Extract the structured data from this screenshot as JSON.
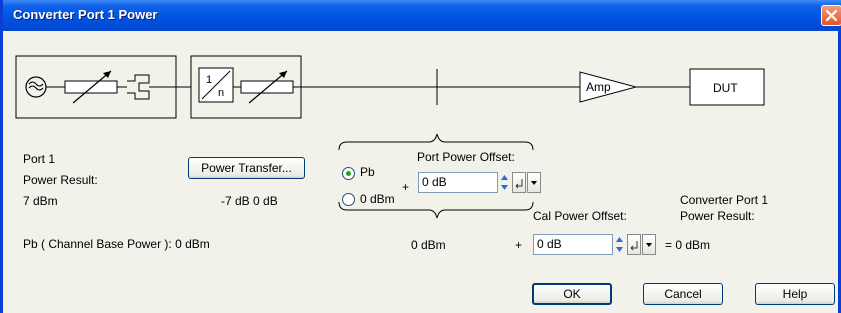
{
  "window": {
    "title": "Converter Port 1 Power"
  },
  "diagram": {
    "divider_label": "1",
    "divider_sublabel": "n",
    "amp_label": "Amp",
    "dut_label": "DUT"
  },
  "left_panel": {
    "port_label": "Port 1",
    "power_result_label": "Power Result:",
    "power_result_value": "7 dBm",
    "power_transfer_button": "Power Transfer...",
    "transfer_values": "-7 dB  0 dB",
    "channel_base_power": "Pb ( Channel Base Power ): 0 dBm"
  },
  "port_power": {
    "offset_label": "Port Power Offset:",
    "radio_options": [
      {
        "label": "Pb",
        "selected": true
      },
      {
        "label": "0 dBm",
        "selected": false
      }
    ],
    "plus_sign": "+",
    "offset_value": "0 dB"
  },
  "cal_power": {
    "offset_label": "Cal Power Offset:",
    "base_value": "0 dBm",
    "plus_sign": "+",
    "offset_value": "0 dB",
    "equals_result": "= 0 dBm"
  },
  "converter_result": {
    "label_line1": "Converter Port 1",
    "label_line2": "Power Result:"
  },
  "buttons": {
    "ok": "OK",
    "cancel": "Cancel",
    "help": "Help"
  },
  "icons": [
    "close-icon",
    "signal-source-icon",
    "attenuator-icon",
    "switch-icon",
    "divider-icon",
    "spin-icon",
    "enter-icon",
    "dropdown-arrow-icon"
  ],
  "colors": {
    "titlebar": "#0054e3",
    "close": "#e0562a",
    "dialog": "#f2f1ea",
    "radio_selected": "#21a121"
  }
}
